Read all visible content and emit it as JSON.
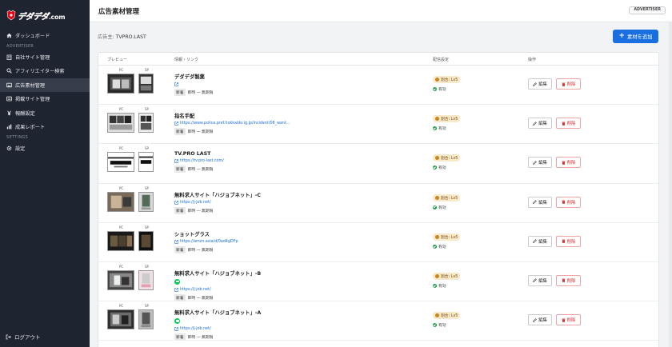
{
  "brand": {
    "logo_text": "デダデダ",
    "logo_suffix": ".com"
  },
  "sidebar": {
    "items": [
      {
        "label": "ダッシュボード",
        "icon": "home-icon"
      },
      {
        "label": "自社サイト管理",
        "icon": "building-icon"
      },
      {
        "label": "アフィリエイター検索",
        "icon": "search-icon"
      },
      {
        "label": "広告素材管理",
        "icon": "image-icon"
      },
      {
        "label": "掲載サイト管理",
        "icon": "list-icon"
      },
      {
        "label": "報酬設定",
        "icon": "yen-icon"
      },
      {
        "label": "成果レポート",
        "icon": "chart-icon"
      },
      {
        "label": "設定",
        "icon": "gear-icon"
      }
    ],
    "section_advertiser": "ADVERTISER",
    "section_settings": "SETTINGS",
    "logout": "ログアウト",
    "active_index": 3
  },
  "header": {
    "title": "広告素材管理",
    "role_badge": "ADVERTISER"
  },
  "main": {
    "advertiser_label": "広告主:",
    "advertiser_name": "TVPRO.LAST",
    "add_button": "素材を追加"
  },
  "table": {
    "columns": [
      "プレビュー",
      "情報・リンク",
      "配信設定",
      "操作"
    ],
    "pc_label": "PC",
    "sp_label": "SP",
    "rows": [
      {
        "title": "デダデダ製薬",
        "link": "",
        "has_line": false,
        "tag": "新着",
        "status_text": "即時 ― 無期限",
        "dist": "割合: Lv5",
        "active": "有効",
        "edit": "編集",
        "del": "削除"
      },
      {
        "title": "指名手配",
        "link": "https://www.police.pref.hokkaido.lg.jp/incident/08_want...",
        "has_line": false,
        "tag": "新着",
        "status_text": "即時 ― 無期限",
        "dist": "割合: Lv5",
        "active": "有効",
        "edit": "編集",
        "del": "削除"
      },
      {
        "title": "TV.PRO LAST",
        "link": "https://tv.pro-last.com/",
        "has_line": false,
        "tag": "新着",
        "status_text": "即時 ― 無期限",
        "dist": "割合: Lv5",
        "active": "有効",
        "edit": "編集",
        "del": "削除"
      },
      {
        "title": "無料求人サイト「ハジョブネット」-C",
        "link": "https://j-job.net/",
        "has_line": false,
        "tag": "新着",
        "status_text": "即時 ― 無期限",
        "dist": "割合: Lv5",
        "active": "有効",
        "edit": "編集",
        "del": "削除"
      },
      {
        "title": "ショットグラス",
        "link": "https://amzn.asia/d/0ad4gDFp",
        "has_line": false,
        "tag": "新着",
        "status_text": "即時 ― 無期限",
        "dist": "割合: Lv5",
        "active": "有効",
        "edit": "編集",
        "del": "削除"
      },
      {
        "title": "無料求人サイト「ハジョブネット」-B",
        "link": "https://j-job.net/",
        "has_line": true,
        "tag": "新着",
        "status_text": "即時 ― 無期限",
        "dist": "割合: Lv5",
        "active": "有効",
        "edit": "編集",
        "del": "削除"
      },
      {
        "title": "無料求人サイト「ハジョブネット」-A",
        "link": "https://j-job.net/",
        "has_line": true,
        "tag": "新着",
        "status_text": "即時 ― 無期限",
        "dist": "割合: Lv5",
        "active": "有効",
        "edit": "編集",
        "del": "削除"
      }
    ]
  },
  "colors": {
    "sidebar_bg": "#1e2430",
    "accent": "#1a6fe0",
    "danger": "#d93030",
    "success": "#1e9e4a",
    "brand_red": "#e60012"
  }
}
